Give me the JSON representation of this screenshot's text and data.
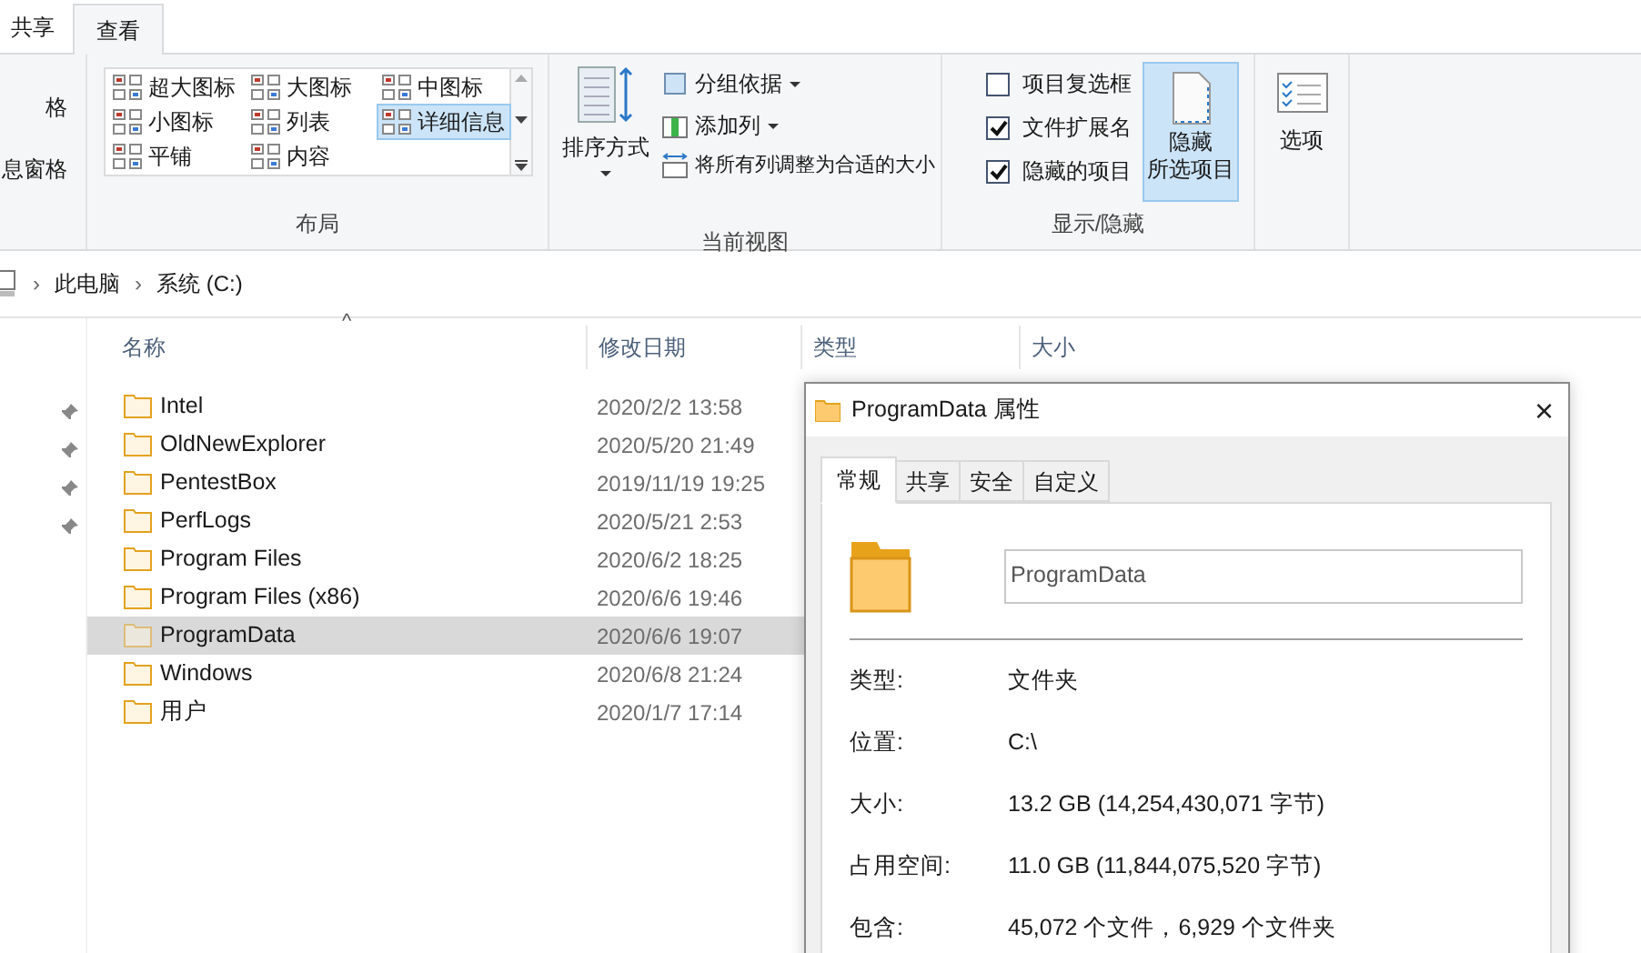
{
  "ribbon_tabs": [
    {
      "label": "共享",
      "selected": false
    },
    {
      "label": "查看",
      "selected": true
    }
  ],
  "panes_group": {
    "items": [
      "格",
      "息窗格"
    ]
  },
  "layout_group": {
    "label": "布局",
    "items": [
      {
        "label": "超大图标",
        "selected": false
      },
      {
        "label": "大图标",
        "selected": false
      },
      {
        "label": "中图标",
        "selected": false
      },
      {
        "label": "小图标",
        "selected": false
      },
      {
        "label": "列表",
        "selected": false
      },
      {
        "label": "详细信息",
        "selected": true
      },
      {
        "label": "平铺",
        "selected": false
      },
      {
        "label": "内容",
        "selected": false
      }
    ]
  },
  "current_view_group": {
    "label": "当前视图",
    "sort_button": "排序方式",
    "group_by": "分组依据",
    "add_column": "添加列",
    "fit_columns": "将所有列调整为合适的大小"
  },
  "show_hide_group": {
    "label": "显示/隐藏",
    "checkboxes": [
      {
        "label": "项目复选框",
        "checked": false
      },
      {
        "label": "文件扩展名",
        "checked": true
      },
      {
        "label": "隐藏的项目",
        "checked": true
      }
    ],
    "hide_selected_button": {
      "line_1": "隐藏",
      "line_2": "所选项目"
    }
  },
  "options_button": "选项",
  "breadcrumb_separator": "›",
  "breadcrumb": [
    "此电脑",
    "系统 (C:)"
  ],
  "sort_indicator": "^",
  "columns": [
    "名称",
    "修改日期",
    "类型",
    "大小"
  ],
  "rows": [
    {
      "name": "Intel",
      "modified": "2020/2/2 13:58",
      "pinned": true,
      "selected": false
    },
    {
      "name": "OldNewExplorer",
      "modified": "2020/5/20 21:49",
      "pinned": true,
      "selected": false
    },
    {
      "name": "PentestBox",
      "modified": "2019/11/19 19:25",
      "pinned": true,
      "selected": false
    },
    {
      "name": "PerfLogs",
      "modified": "2020/5/21 2:53",
      "pinned": true,
      "selected": false
    },
    {
      "name": "Program Files",
      "modified": "2020/6/2 18:25",
      "pinned": false,
      "selected": false
    },
    {
      "name": "Program Files (x86)",
      "modified": "2020/6/6 19:46",
      "pinned": false,
      "selected": false
    },
    {
      "name": "ProgramData",
      "modified": "2020/6/6 19:07",
      "pinned": false,
      "selected": true
    },
    {
      "name": "Windows",
      "modified": "2020/6/8 21:24",
      "pinned": false,
      "selected": false
    },
    {
      "name": "用户",
      "modified": "2020/1/7 17:14",
      "pinned": false,
      "selected": false
    }
  ],
  "dialog": {
    "title": "ProgramData 属性",
    "close": "×",
    "tabs": [
      {
        "label": "常规",
        "selected": true
      },
      {
        "label": "共享",
        "selected": false
      },
      {
        "label": "安全",
        "selected": false
      },
      {
        "label": "自定义",
        "selected": false
      }
    ],
    "name_field": "ProgramData",
    "properties": [
      {
        "label": "类型:",
        "value": "文件夹"
      },
      {
        "label": "位置:",
        "value": "C:\\"
      },
      {
        "label": "大小:",
        "value": "13.2 GB (14,254,430,071 字节)"
      },
      {
        "label": "占用空间:",
        "value": "11.0 GB (11,844,075,520 字节)"
      },
      {
        "label": "包含:",
        "value": "45,072 个文件，6,929 个文件夹"
      }
    ]
  }
}
